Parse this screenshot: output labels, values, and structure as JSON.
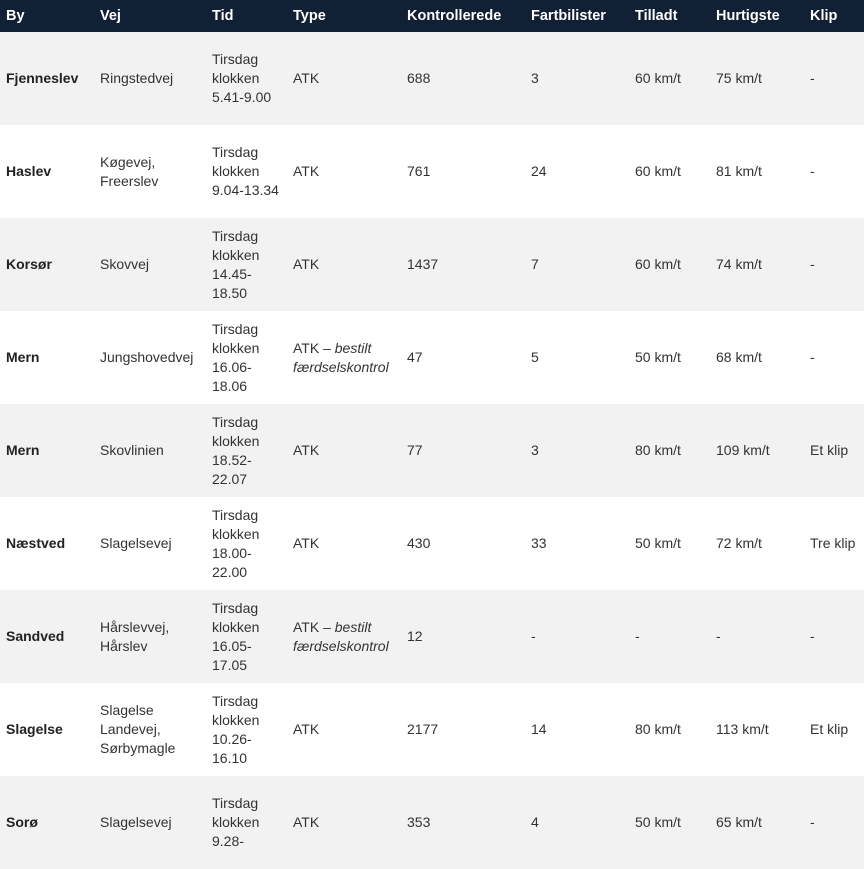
{
  "header": {
    "columns": [
      "By",
      "Vej",
      "Tid",
      "Type",
      "Kontrollerede",
      "Fartbilister",
      "Tilladt",
      "Hurtigste",
      "Klip"
    ]
  },
  "rows": [
    {
      "by": "Fjenneslev",
      "vej": "Ringstedvej",
      "tid": "Tirsdag klokken 5.41-9.00",
      "type": "ATK",
      "type_note": "",
      "kontrollerede": "688",
      "fartbilister": "3",
      "tilladt": "60 km/t",
      "hurtigste": "75 km/t",
      "klip": "-"
    },
    {
      "by": "Haslev",
      "vej": "Køgevej, Freerslev",
      "tid": "Tirsdag klokken 9.04-13.34",
      "type": "ATK",
      "type_note": "",
      "kontrollerede": "761",
      "fartbilister": "24",
      "tilladt": "60 km/t",
      "hurtigste": "81 km/t",
      "klip": "-"
    },
    {
      "by": "Korsør",
      "vej": "Skovvej",
      "tid": "Tirsdag klokken 14.45-18.50",
      "type": "ATK",
      "type_note": "",
      "kontrollerede": "1437",
      "fartbilister": "7",
      "tilladt": "60 km/t",
      "hurtigste": "74 km/t",
      "klip": "-"
    },
    {
      "by": "Mern",
      "vej": "Jungshovedvej",
      "tid": "Tirsdag klokken 16.06-18.06",
      "type": "ATK – ",
      "type_note": "bestilt færdselskontrol",
      "kontrollerede": "47",
      "fartbilister": "5",
      "tilladt": "50 km/t",
      "hurtigste": "68 km/t",
      "klip": "-"
    },
    {
      "by": "Mern",
      "vej": "Skovlinien",
      "tid": "Tirsdag klokken 18.52-22.07",
      "type": "ATK",
      "type_note": "",
      "kontrollerede": "77",
      "fartbilister": "3",
      "tilladt": "80 km/t",
      "hurtigste": "109 km/t",
      "klip": "Et klip"
    },
    {
      "by": "Næstved",
      "vej": "Slagelsevej",
      "tid": "Tirsdag klokken 18.00-22.00",
      "type": "ATK",
      "type_note": "",
      "kontrollerede": "430",
      "fartbilister": "33",
      "tilladt": "50 km/t",
      "hurtigste": "72 km/t",
      "klip": "Tre klip"
    },
    {
      "by": "Sandved",
      "vej": "Hårslevvej, Hårslev",
      "tid": "Tirsdag klokken 16.05-17.05",
      "type": "ATK – ",
      "type_note": "bestilt færdselskontrol",
      "kontrollerede": "12",
      "fartbilister": "-",
      "tilladt": "-",
      "hurtigste": "-",
      "klip": "-"
    },
    {
      "by": "Slagelse",
      "vej": "Slagelse Landevej, Sørbymagle",
      "tid": "Tirsdag klokken 10.26-16.10",
      "type": "ATK",
      "type_note": "",
      "kontrollerede": "2177",
      "fartbilister": "14",
      "tilladt": "80 km/t",
      "hurtigste": "113 km/t",
      "klip": "Et klip"
    },
    {
      "by": "Sorø",
      "vej": "Slagelsevej",
      "tid": "Tirsdag klokken 9.28-",
      "type": "ATK",
      "type_note": "",
      "kontrollerede": "353",
      "fartbilister": "4",
      "tilladt": "50 km/t",
      "hurtigste": "65 km/t",
      "klip": "-"
    }
  ]
}
